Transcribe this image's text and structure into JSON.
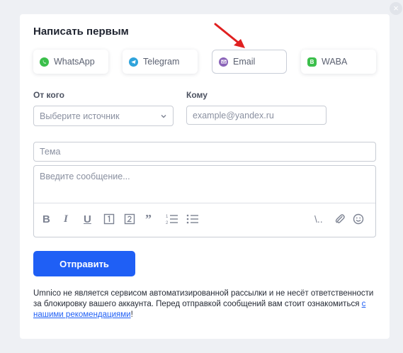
{
  "modal": {
    "title": "Написать первым",
    "close_label": "×"
  },
  "channels": [
    {
      "label": "WhatsApp",
      "icon": "whatsapp-icon",
      "color": "#3bbf4b"
    },
    {
      "label": "Telegram",
      "icon": "telegram-icon",
      "color": "#2fa3db"
    },
    {
      "label": "Email",
      "icon": "email-icon",
      "color": "#8a63b8",
      "selected": true
    },
    {
      "label": "WABA",
      "icon": "waba-icon",
      "color": "#3bbf4b"
    }
  ],
  "form": {
    "from_label": "От кого",
    "from_value": "Выберите источник",
    "to_label": "Кому",
    "to_placeholder": "example@yandex.ru",
    "subject_placeholder": "Тема",
    "message_placeholder": "Введите сообщение..."
  },
  "toolbar": {
    "left": [
      "bold-icon",
      "italic-icon",
      "underline-icon",
      "heading-1-icon",
      "heading-2-icon",
      "quote-icon",
      "ordered-list-icon",
      "bullet-list-icon"
    ],
    "right": [
      "variable-icon",
      "attach-icon",
      "emoji-icon"
    ],
    "variable_text": "\\.."
  },
  "send_label": "Отправить",
  "disclaimer": {
    "text": "Umnico не является сервисом автоматизированной рассылки и не несёт ответственности за блокировку вашего аккаунта. Перед отправкой сообщений вам стоит ознакомиться ",
    "link": "с нашими рекомендациями",
    "suffix": "!"
  },
  "colors": {
    "accent": "#1f5ff5",
    "annotation_arrow": "#e02020"
  }
}
